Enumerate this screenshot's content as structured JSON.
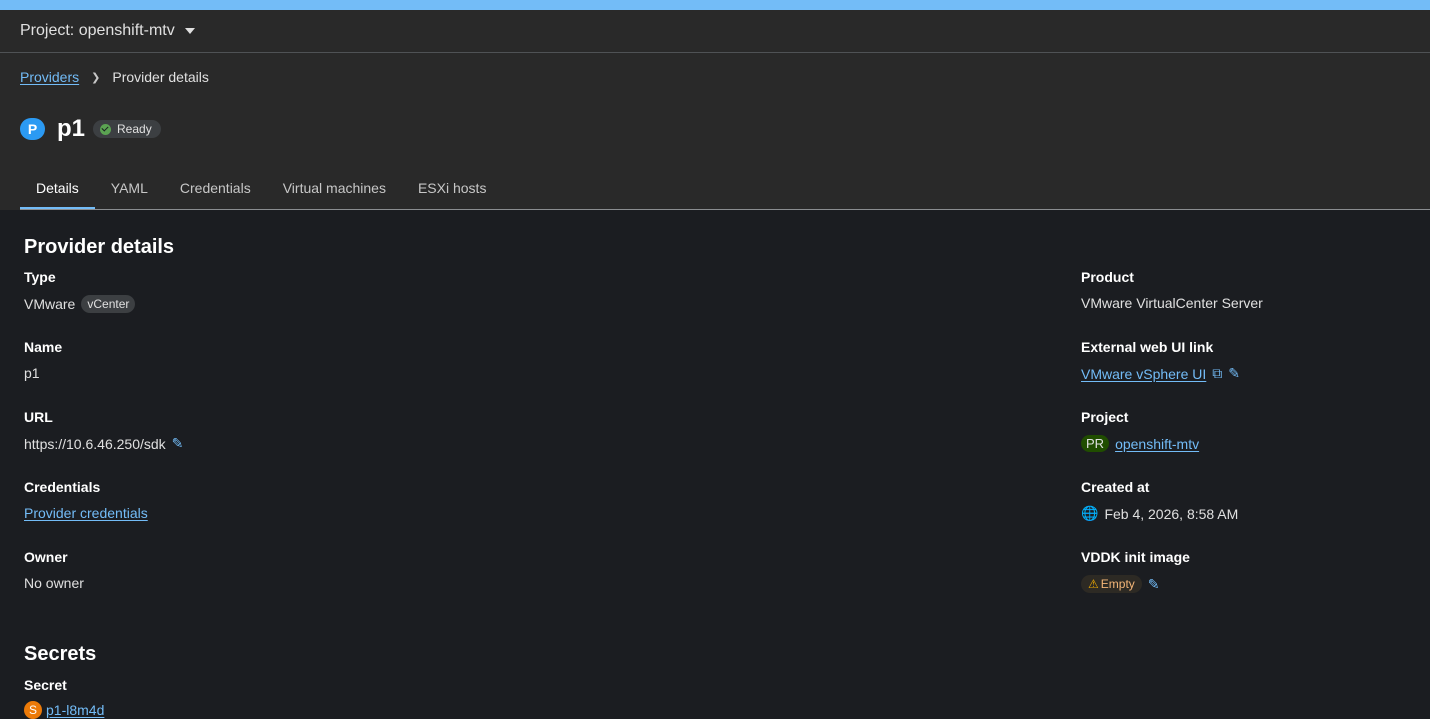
{
  "project_bar": {
    "label": "Project: openshift-mtv"
  },
  "breadcrumb": {
    "parent": "Providers",
    "current": "Provider details"
  },
  "header": {
    "badge": "P",
    "title": "p1",
    "status": "Ready"
  },
  "tabs": [
    "Details",
    "YAML",
    "Credentials",
    "Virtual machines",
    "ESXi hosts"
  ],
  "details": {
    "section_title": "Provider details",
    "type": {
      "label": "Type",
      "value": "VMware",
      "pill": "vCenter"
    },
    "name": {
      "label": "Name",
      "value": "p1"
    },
    "url": {
      "label": "URL",
      "value": "https://10.6.46.250/sdk"
    },
    "credentials": {
      "label": "Credentials",
      "value": "Provider credentials"
    },
    "owner": {
      "label": "Owner",
      "value": "No owner"
    },
    "product": {
      "label": "Product",
      "value": "VMware VirtualCenter Server"
    },
    "external_link": {
      "label": "External web UI link",
      "value": "VMware vSphere UI"
    },
    "project": {
      "label": "Project",
      "badge": "PR",
      "value": "openshift-mtv"
    },
    "created_at": {
      "label": "Created at",
      "value": "Feb 4, 2026, 8:58 AM"
    },
    "vddk": {
      "label": "VDDK init image",
      "value": "Empty"
    }
  },
  "secrets": {
    "section_title": "Secrets",
    "label": "Secret",
    "badge": "S",
    "value": "p1-l8m4d"
  },
  "colors": {
    "accent": "#73bcf7",
    "badge_blue": "#2b9af3",
    "success": "#5ba352",
    "warning": "#f0ab00"
  }
}
